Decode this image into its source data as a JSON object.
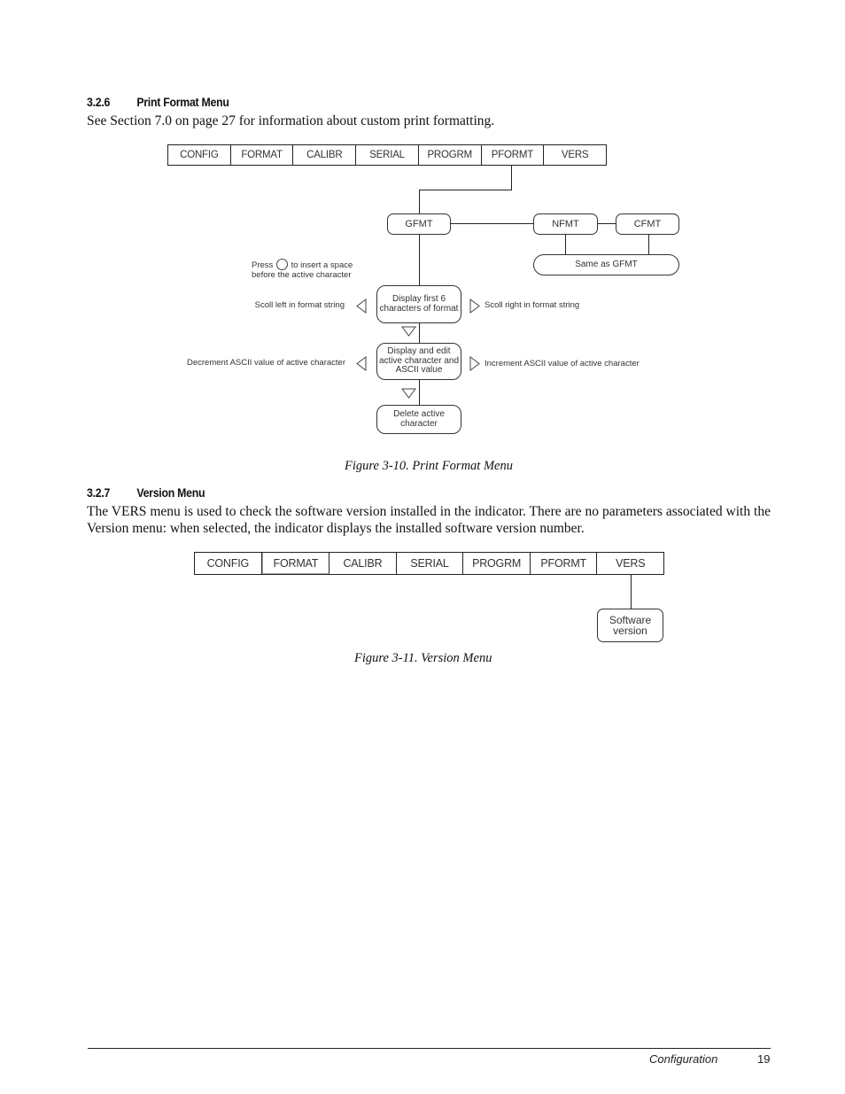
{
  "section_326": {
    "number": "3.2.6",
    "title": "Print Format Menu",
    "body": "See Section 7.0 on page 27 for information about custom print formatting."
  },
  "figure_3_10": {
    "menu": [
      "CONFIG",
      "FORMAT",
      "CALIBR",
      "SERIAL",
      "PROGRM",
      "PFORMT",
      "VERS"
    ],
    "nodes": {
      "gfmt": "GFMT",
      "nfmt": "NFMT",
      "cfmt": "CFMT",
      "same_as": "Same as GFMT",
      "display_first": "Display first 6 characters of format",
      "display_edit": "Display and edit active character and ASCII value",
      "delete": "Delete active character"
    },
    "notes": {
      "press_prefix": "Press",
      "press_suffix": "to insert a space",
      "press_line2": "before the active character",
      "scroll_left": "Scoll left in format string",
      "scroll_right": "Scoll right in format string",
      "decrement": "Decrement ASCII value of active character",
      "increment": "Increment ASCII value of active character"
    },
    "icons": {
      "press_button": "round-button-icon",
      "left": "left-arrow-icon",
      "right": "right-arrow-icon",
      "down": "down-arrow-icon"
    },
    "caption": "Figure 3-10. Print Format Menu"
  },
  "section_327": {
    "number": "3.2.7",
    "title": "Version Menu",
    "body": "The VERS menu is used to check the software version installed in the indicator. There are no parameters associated with the Version menu: when selected, the indicator displays the installed software version number."
  },
  "figure_3_11": {
    "menu": [
      "CONFIG",
      "FORMAT",
      "CALIBR",
      "SERIAL",
      "PROGRM",
      "PFORMT",
      "VERS"
    ],
    "node": "Software version",
    "caption": "Figure 3-11. Version Menu"
  },
  "footer": {
    "section": "Configuration",
    "page": "19"
  }
}
